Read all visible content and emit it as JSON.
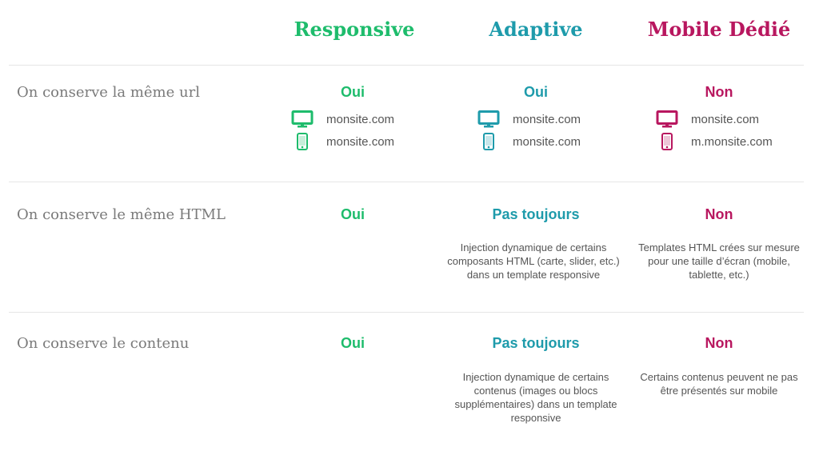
{
  "colors": {
    "responsive": "#1ebc6c",
    "adaptive": "#1e9bab",
    "mobile": "#b8175f"
  },
  "columns": [
    "Responsive",
    "Adaptive",
    "Mobile Dédié"
  ],
  "rows": [
    {
      "label": "On conserve la même url",
      "responsive": {
        "answer": "Oui",
        "desktop": "monsite.com",
        "mobile": "monsite.com"
      },
      "adaptive": {
        "answer": "Oui",
        "desktop": "monsite.com",
        "mobile": "monsite.com"
      },
      "mobile": {
        "answer": "Non",
        "desktop": "monsite.com",
        "mobile": "m.monsite.com"
      }
    },
    {
      "label": "On conserve le même HTML",
      "responsive": {
        "answer": "Oui"
      },
      "adaptive": {
        "answer": "Pas toujours",
        "note": "Injection dynamique de certains composants HTML (carte, slider, etc.) dans un template responsive"
      },
      "mobile": {
        "answer": "Non",
        "note": "Templates HTML crées sur mesure pour une taille d’écran (mobile, tablette, etc.)"
      }
    },
    {
      "label": "On conserve le contenu",
      "responsive": {
        "answer": "Oui"
      },
      "adaptive": {
        "answer": "Pas toujours",
        "note": "Injection dynamique de certains contenus (images ou blocs supplémentaires) dans un template responsive"
      },
      "mobile": {
        "answer": "Non",
        "note": "Certains contenus peuvent ne pas être présentés sur mobile"
      }
    }
  ]
}
